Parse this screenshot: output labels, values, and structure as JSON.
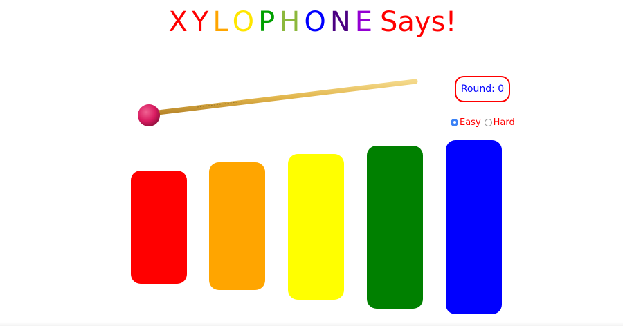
{
  "title": {
    "letters": [
      {
        "char": "X",
        "color": "#ff0000"
      },
      {
        "char": "Y",
        "color": "#ff0000"
      },
      {
        "char": "L",
        "color": "#ffa500"
      },
      {
        "char": "O",
        "color": "#ffe600"
      },
      {
        "char": "P",
        "color": "#00a000"
      },
      {
        "char": "H",
        "color": "#8cb83c"
      },
      {
        "char": "O",
        "color": "#0000ff"
      },
      {
        "char": "N",
        "color": "#4b0082"
      },
      {
        "char": "E",
        "color": "#9400d3"
      }
    ],
    "suffix": "Says!",
    "suffix_color": "#ff0000"
  },
  "round": {
    "label": "Round: 0"
  },
  "mode": {
    "options": [
      {
        "label": "Easy",
        "selected": true
      },
      {
        "label": "Hard",
        "selected": false
      }
    ]
  },
  "mallet": {
    "icon": "mallet-icon",
    "head_color": "#d81b60",
    "stick_color": "#e8c25e"
  },
  "bars": [
    {
      "name": "red",
      "color": "#ff0000"
    },
    {
      "name": "orange",
      "color": "#ffa500"
    },
    {
      "name": "yellow",
      "color": "#ffff00"
    },
    {
      "name": "green",
      "color": "#008000"
    },
    {
      "name": "blue",
      "color": "#0000ff"
    }
  ]
}
